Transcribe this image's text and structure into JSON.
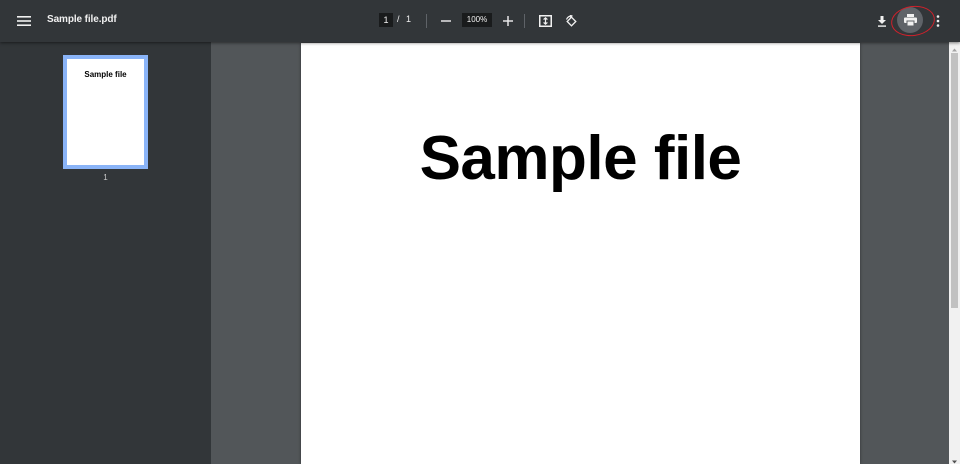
{
  "toolbar": {
    "file_title": "Sample file.pdf",
    "page_current": "1",
    "page_separator": "/",
    "page_total": "1",
    "zoom": "100%",
    "icons": [
      "menu-icon",
      "zoom-out-icon",
      "zoom-in-icon",
      "fit-page-icon",
      "rotate-icon",
      "download-icon",
      "print-icon",
      "more-icon"
    ]
  },
  "sidebar": {
    "thumbnail": {
      "title": "Sample file",
      "page_number": "1",
      "selected": true
    }
  },
  "document": {
    "heading": "Sample file"
  },
  "annotation": {
    "target": "print-button",
    "color": "#d0212b"
  },
  "colors": {
    "toolbar": "#323639",
    "viewer_background": "#525659",
    "thumbnail_highlight": "#8ab4f8"
  }
}
